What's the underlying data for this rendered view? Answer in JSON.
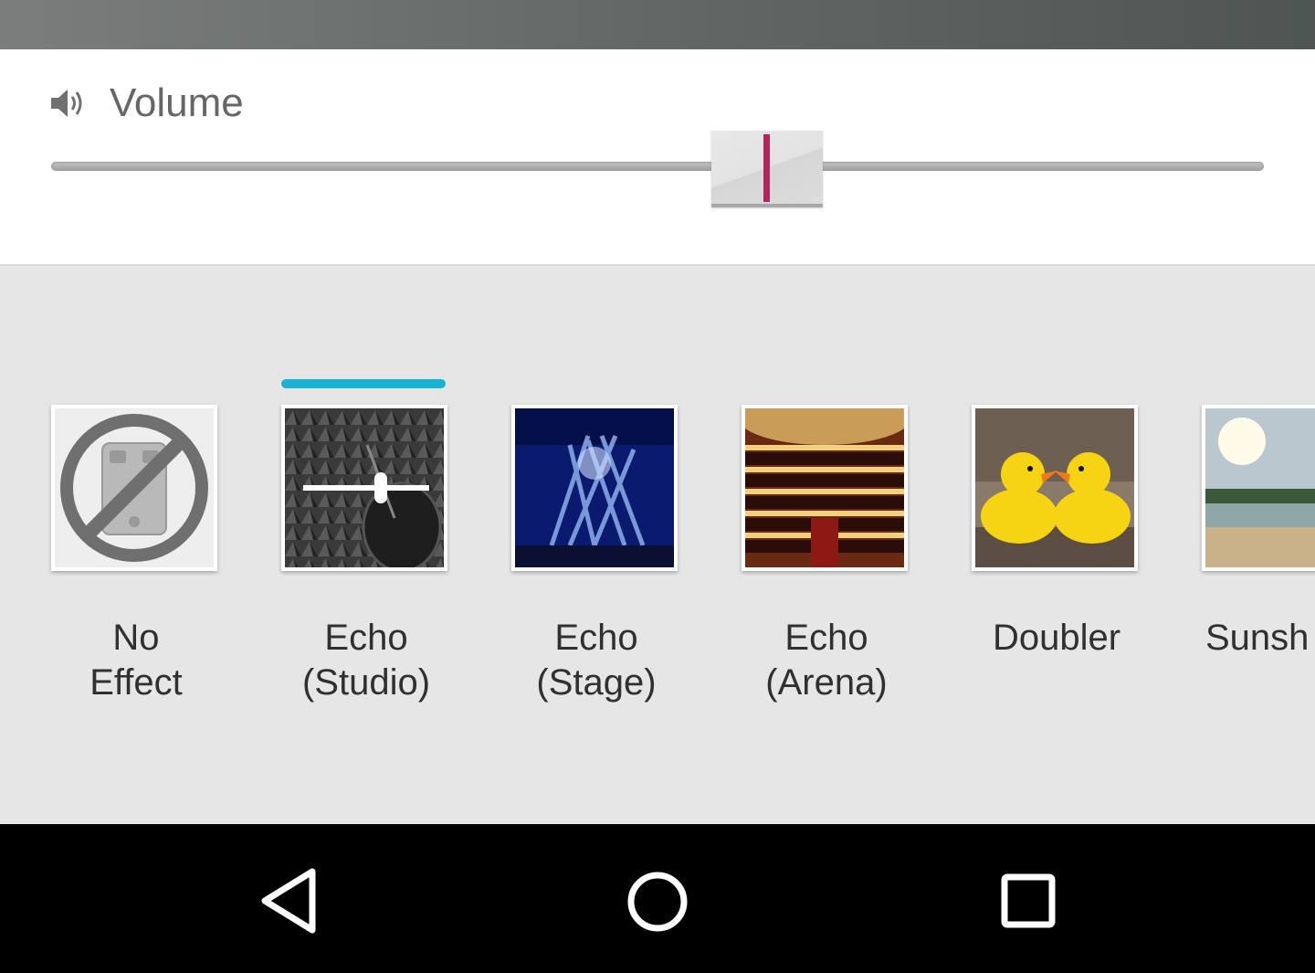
{
  "volume": {
    "label": "Volume",
    "icon": "speaker-icon",
    "level_fraction": 0.59,
    "accent_color": "#b3245a"
  },
  "effects": {
    "selected_index": 1,
    "selection_color": "#1ab2d2",
    "items": [
      {
        "label": "No\nEffect",
        "icon": "no-effect-icon"
      },
      {
        "label": "Echo\n(Studio)",
        "icon": "studio-image"
      },
      {
        "label": "Echo\n(Stage)",
        "icon": "stage-image"
      },
      {
        "label": "Echo\n(Arena)",
        "icon": "arena-image"
      },
      {
        "label": "Doubler",
        "icon": "ducks-image"
      },
      {
        "label": "Sunsh",
        "icon": "beach-image"
      }
    ]
  },
  "navbar": {
    "buttons": [
      "back-icon",
      "home-icon",
      "recents-icon"
    ]
  }
}
